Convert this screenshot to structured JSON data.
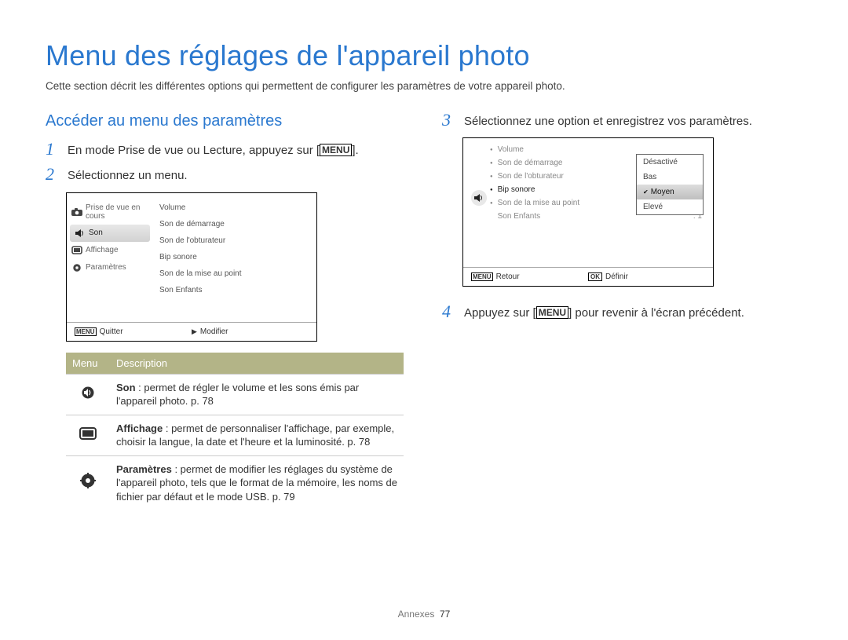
{
  "title": "Menu des réglages de l'appareil photo",
  "intro": "Cette section décrit les différentes options qui permettent de configurer les paramètres de votre appareil photo.",
  "section_heading": "Accéder au menu des paramètres",
  "steps": {
    "s1_pre": "En mode Prise de vue ou Lecture, appuyez sur [",
    "s1_btn": "MENU",
    "s1_post": "].",
    "s2": "Sélectionnez un menu.",
    "s3": "Sélectionnez une option et enregistrez vos paramètres.",
    "s4_pre": "Appuyez sur [",
    "s4_btn": "MENU",
    "s4_post": "] pour revenir à l'écran précédent."
  },
  "shot1": {
    "sidebar": {
      "prise": "Prise de vue en cours",
      "son": "Son",
      "affichage": "Affichage",
      "param": "Paramètres"
    },
    "list": {
      "volume": "Volume",
      "sondem": "Son de démarrage",
      "sonobt": "Son de l'obturateur",
      "bip": "Bip sonore",
      "sonmap": "Son de la mise au point",
      "sonenf": "Son Enfants"
    },
    "foot_menu_badge": "MENU",
    "foot_quit": "Quitter",
    "foot_mod": "Modifier"
  },
  "shot2": {
    "list": {
      "volume": "Volume",
      "sondem": "Son de démarrage",
      "sonobt": "Son de l'obturateur",
      "bip": "Bip sonore",
      "sonmap": "Son de la mise au point",
      "sonenf": "Son Enfants",
      "sonenf_val": ": 1"
    },
    "popup": {
      "desact": "Désactivé",
      "bas": "Bas",
      "moyen": "Moyen",
      "eleve": "Elevé"
    },
    "foot_menu_badge": "MENU",
    "foot_ret": "Retour",
    "foot_ok_badge": "OK",
    "foot_def": "Définir"
  },
  "table": {
    "hdr_menu": "Menu",
    "hdr_desc": "Description",
    "row_son_title": "Son",
    "row_son_body": " : permet de régler le volume et les sons émis par l'appareil photo. p. 78",
    "row_aff_title": "Affichage",
    "row_aff_body": " : permet de personnaliser l'affichage, par exemple, choisir la langue, la date et l'heure et la luminosité. p. 78",
    "row_par_title": "Paramètres",
    "row_par_body": " : permet de modifier les réglages du système de l'appareil photo, tels que le format de la mémoire, les noms de fichier par défaut et le mode USB. p. 79"
  },
  "footer": {
    "label": "Annexes",
    "page": "77"
  }
}
